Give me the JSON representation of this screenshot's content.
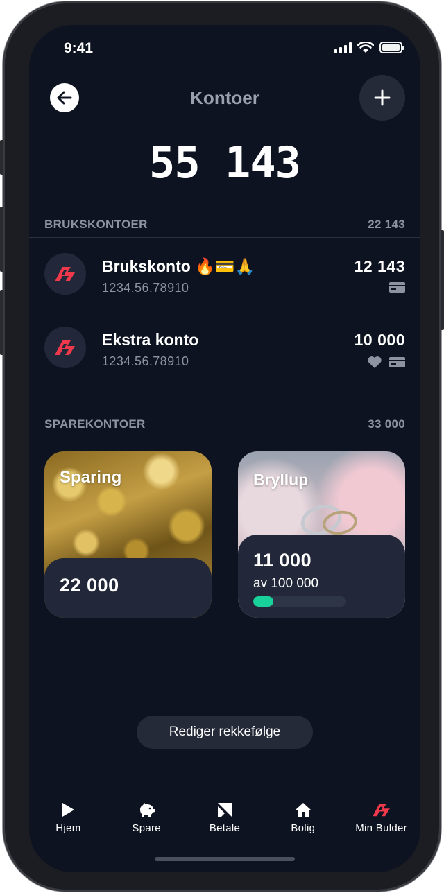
{
  "status_bar": {
    "time": "9:41"
  },
  "header": {
    "title": "Kontoer"
  },
  "total_balance": "55 143",
  "brukskontoer": {
    "heading": "BRUKSKONTOER",
    "sum": "22 143",
    "accounts": [
      {
        "name": "Brukskonto 🔥💳🙏",
        "number": "1234.56.78910",
        "amount": "12 143",
        "icons": [
          "card-icon"
        ]
      },
      {
        "name": "Ekstra konto",
        "number": "1234.56.78910",
        "amount": "10 000",
        "icons": [
          "heart-icon",
          "card-icon"
        ]
      }
    ]
  },
  "sparekontoer": {
    "heading": "SPAREKONTOER",
    "sum": "33 000",
    "cards": [
      {
        "title": "Sparing",
        "amount": "22 000",
        "image": "gold-nuggets"
      },
      {
        "title": "Bryllup",
        "amount": "11 000",
        "goal": "av 100 000",
        "progress": 0.11,
        "image": "wedding-rings"
      }
    ]
  },
  "reorder_button": "Rediger rekkefølge",
  "tabbar": [
    {
      "label": "Hjem",
      "icon": "play-icon"
    },
    {
      "label": "Spare",
      "icon": "piggy-bank-icon"
    },
    {
      "label": "Betale",
      "icon": "payment-icon"
    },
    {
      "label": "Bolig",
      "icon": "house-icon"
    },
    {
      "label": "Min Bulder",
      "icon": "bulder-logo-icon"
    }
  ],
  "colors": {
    "background": "#0d1320",
    "surface": "#222839",
    "brand_red": "#f0394a",
    "progress_green": "#19d19a",
    "muted_text": "#8d939f"
  }
}
